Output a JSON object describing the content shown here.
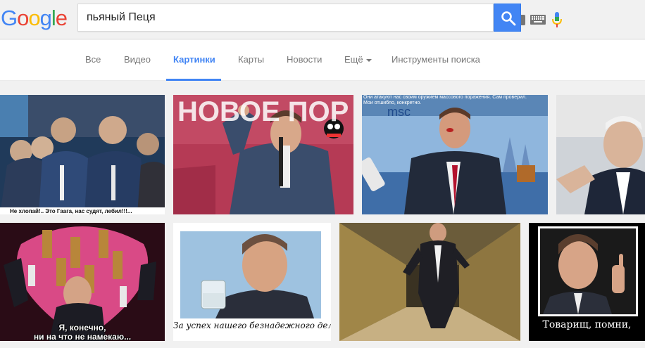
{
  "logo": {
    "letters": [
      "G",
      "o",
      "o",
      "g",
      "l",
      "e"
    ],
    "colors": [
      "#4285f4",
      "#ea4335",
      "#fbbc05",
      "#4285f4",
      "#34a853",
      "#ea4335"
    ]
  },
  "search": {
    "query": "пьяный Пеця"
  },
  "tabs": [
    {
      "label": "Все"
    },
    {
      "label": "Видео"
    },
    {
      "label": "Картинки"
    },
    {
      "label": "Карты"
    },
    {
      "label": "Новости"
    },
    {
      "label": "Ещё"
    },
    {
      "label": "Инструменты поиска"
    }
  ],
  "active_tab": "Картинки",
  "accent_color": "#4285f4",
  "results": [
    {
      "caption": "Не хлопай!.. Это Гаага, нас судят, лебил!!!..."
    },
    {
      "caption": "НОВОЕ ПОР",
      "overlay": "sign-text"
    },
    {
      "caption": "Они атакуют нас своим оружием массового поражения. Сам проверил.",
      "caption2": "Мои отшибло, конкретно.",
      "logo": "msc"
    },
    {
      "caption": ""
    },
    {
      "caption": "Я, конечно,",
      "caption2": "ни на что не намекаю..."
    },
    {
      "caption": "За успех нашего безнадежного дела!"
    },
    {
      "caption": ""
    },
    {
      "caption": "Товарищ, помни,"
    }
  ]
}
